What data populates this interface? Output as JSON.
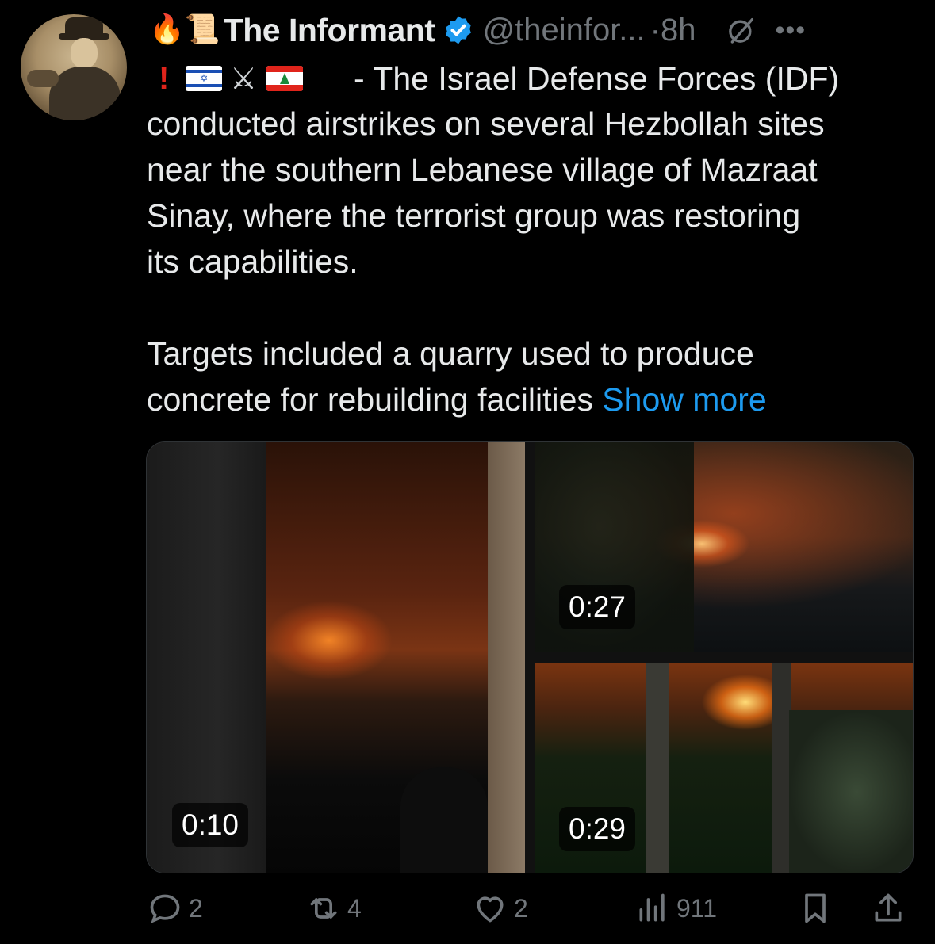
{
  "tweet": {
    "author": {
      "name_emojis": "🔥📜",
      "name": "The Informant",
      "handle": "@theinfor...",
      "time": "·8h"
    },
    "flag_line_text": "- The Israel Defense Forces (IDF)",
    "body_lines": [
      "conducted airstrikes on several Hezbollah sites",
      "near the southern Lebanese village of Mazraat",
      "Sinay, where the terrorist group was restoring",
      "its capabilities."
    ],
    "paragraph2_lines": [
      "Targets included a quarry used to produce",
      "concrete for rebuilding facilities"
    ],
    "show_more": "Show more",
    "media": [
      {
        "duration": "0:10"
      },
      {
        "duration": "0:27"
      },
      {
        "duration": "0:29"
      }
    ],
    "actions": {
      "replies": "2",
      "reposts": "4",
      "likes": "2",
      "views": "911"
    }
  },
  "icons": {
    "verified": "verified-badge-icon",
    "grok": "grok-icon",
    "more": "more-icon",
    "reply": "reply-icon",
    "repost": "repost-icon",
    "like": "like-icon",
    "views": "views-icon",
    "bookmark": "bookmark-icon",
    "share": "share-icon"
  },
  "colors": {
    "background": "#000000",
    "text": "#e7e9ea",
    "muted": "#71767b",
    "link": "#1d9bf0"
  }
}
